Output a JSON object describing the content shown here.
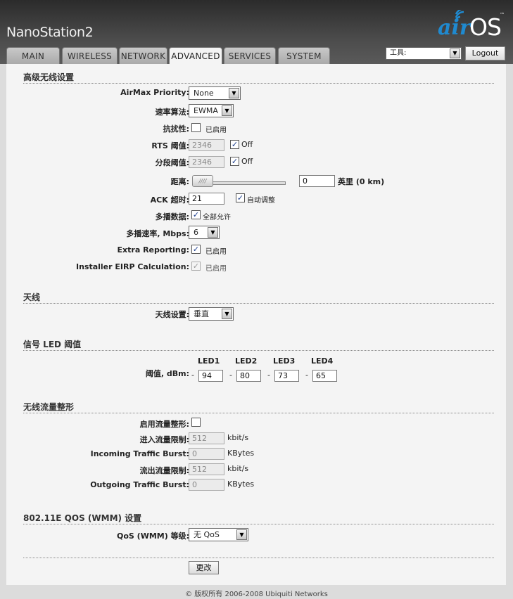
{
  "header": {
    "device_name": "NanoStation2",
    "logo": {
      "air": "air",
      "os": "OS",
      "tm": "™"
    },
    "tabs": [
      "MAIN",
      "WIRELESS",
      "NETWORK",
      "ADVANCED",
      "SERVICES",
      "SYSTEM"
    ],
    "active_tab": "ADVANCED",
    "tools_select": "工具:",
    "logout": "Logout"
  },
  "colors": {
    "header_dark": "#2b2b2b",
    "panel": "#f4f4f4",
    "logo_blue": "#1f8ad0"
  },
  "advanced_wireless": {
    "title": "高级无线设置",
    "airmax_priority": {
      "label": "AirMax Priority:",
      "value": "None"
    },
    "rate_algorithm": {
      "label": "速率算法:",
      "value": "EWMA"
    },
    "noise_immunity": {
      "label": "抗扰性:",
      "checkbox_label": "已启用",
      "checked": false
    },
    "rts_threshold": {
      "label": "RTS 阈值:",
      "value": "2346",
      "off_label": "Off",
      "off_checked": true
    },
    "fragmentation": {
      "label": "分段阈值:",
      "value": "2346",
      "off_label": "Off",
      "off_checked": true
    },
    "distance": {
      "label": "距离:",
      "value": "0",
      "unit": "英里",
      "km": "(0 km)",
      "slider_fraction": 0.0
    },
    "ack_timeout": {
      "label": "ACK 超时:",
      "value": "21",
      "auto_label": "自动调整",
      "auto_checked": true
    },
    "multicast_data": {
      "label": "多播数据:",
      "checkbox_label": "全部允许",
      "checked": true
    },
    "multicast_rate": {
      "label": "多播速率, Mbps:",
      "value": "6"
    },
    "extra_reporting": {
      "label": "Extra Reporting:",
      "checkbox_label": "已启用",
      "checked": true
    },
    "installer_eirp": {
      "label": "Installer EIRP Calculation:",
      "checkbox_label": "已启用",
      "checked": true
    }
  },
  "antenna": {
    "title": "天线",
    "setting": {
      "label": "天线设置:",
      "value": "垂直"
    }
  },
  "signal_led": {
    "title": "信号 LED 阈值",
    "label": "阈值, dBm:",
    "leds": [
      {
        "name": "LED1",
        "value": "94"
      },
      {
        "name": "LED2",
        "value": "80"
      },
      {
        "name": "LED3",
        "value": "73"
      },
      {
        "name": "LED4",
        "value": "65"
      }
    ],
    "dash": "-"
  },
  "traffic_shaping": {
    "title": "无线流量整形",
    "enable": {
      "label": "启用流量整形:",
      "checked": false
    },
    "incoming_limit": {
      "label": "进入流量限制:",
      "placeholder": "512",
      "unit": "kbit/s"
    },
    "incoming_burst": {
      "label": "Incoming Traffic Burst:",
      "placeholder": "0",
      "unit": "KBytes"
    },
    "outgoing_limit": {
      "label": "流出流量限制:",
      "placeholder": "512",
      "unit": "kbit/s"
    },
    "outgoing_burst": {
      "label": "Outgoing Traffic Burst:",
      "placeholder": "0",
      "unit": "KBytes"
    }
  },
  "qos": {
    "title": "802.11E QOS (WMM) 设置",
    "level": {
      "label": "QoS (WMM) 等级:",
      "value": "无 QoS"
    }
  },
  "change_button": "更改",
  "footer": "© 版权所有 2006-2008 Ubiquiti Networks"
}
